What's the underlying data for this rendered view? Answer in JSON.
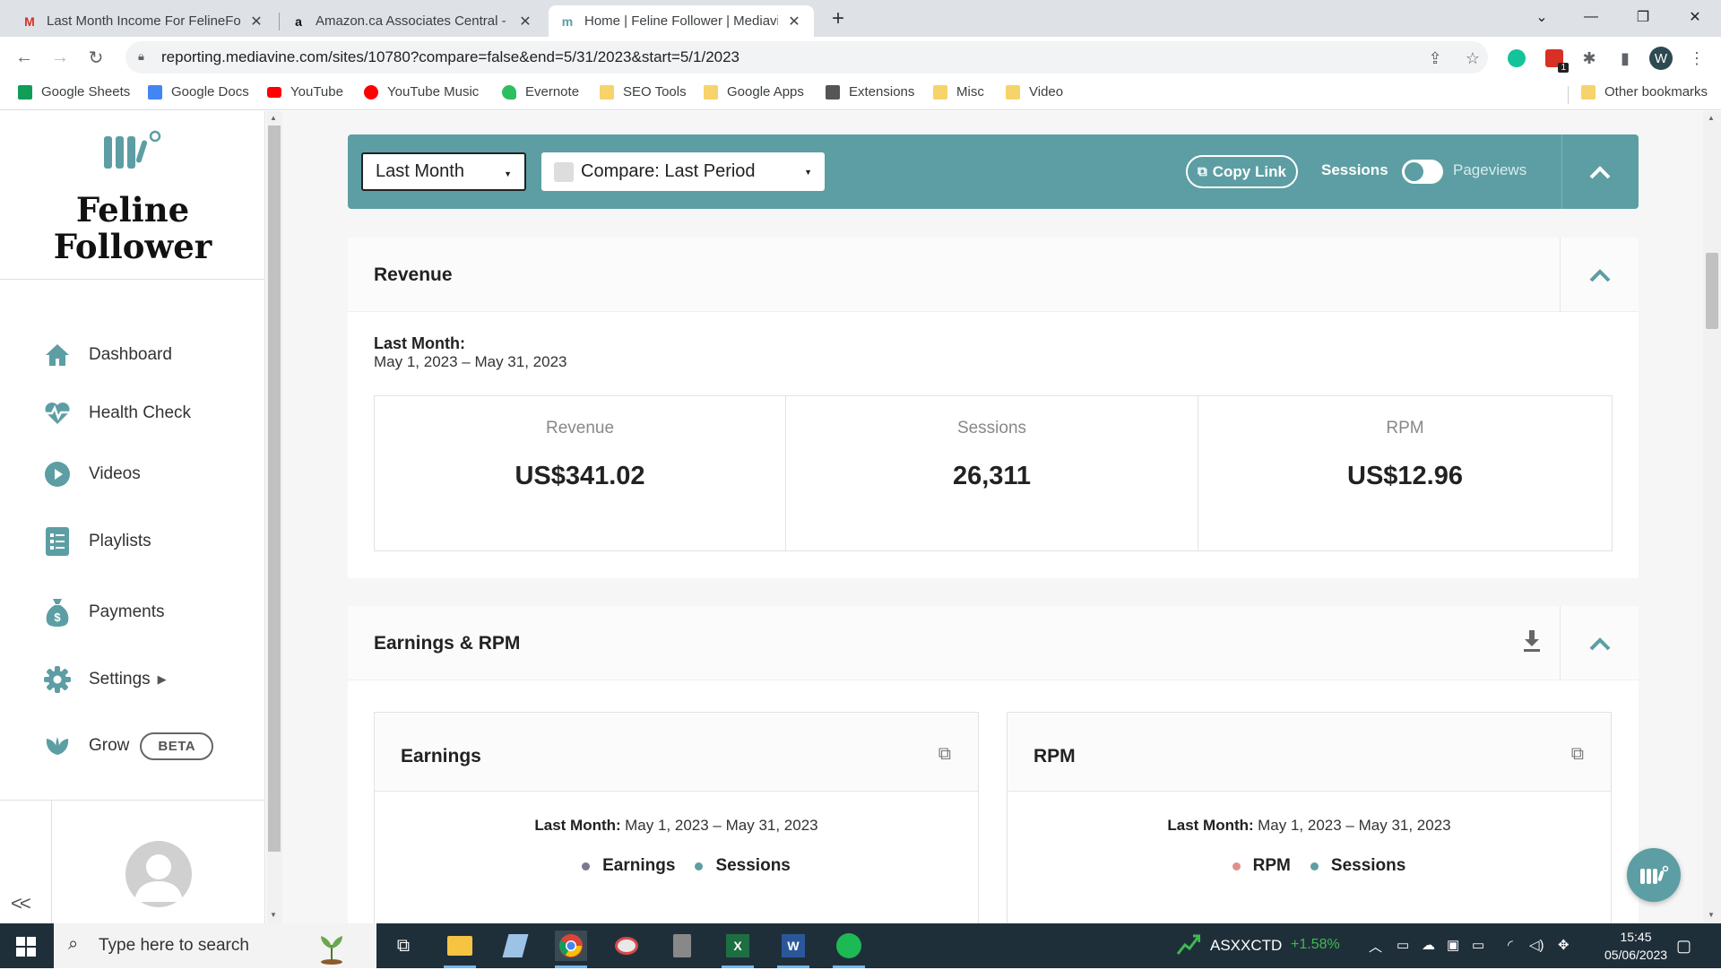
{
  "browser": {
    "tabs": [
      {
        "title": "Last Month Income For FelineFol",
        "favicon": "gmail-icon",
        "active": false
      },
      {
        "title": "Amazon.ca Associates Central - H",
        "favicon": "amazon-icon",
        "active": false
      },
      {
        "title": "Home | Feline Follower | Mediavi",
        "favicon": "mediavine-icon",
        "active": true
      }
    ],
    "url": "reporting.mediavine.com/sites/10780?compare=false&end=5/31/2023&start=5/1/2023",
    "profile_initial": "W",
    "extension_badge": "1",
    "bookmarks": [
      {
        "label": "Google Sheets",
        "color": "#0f9d58"
      },
      {
        "label": "Google Docs",
        "color": "#4285f4"
      },
      {
        "label": "YouTube",
        "color": "#ff0000"
      },
      {
        "label": "YouTube Music",
        "color": "#ff0000"
      },
      {
        "label": "Evernote",
        "color": "#2dbe60"
      },
      {
        "label": "SEO Tools",
        "color": "#f6d36b"
      },
      {
        "label": "Google Apps",
        "color": "#f6d36b"
      },
      {
        "label": "Extensions",
        "color": "#555555"
      },
      {
        "label": "Misc",
        "color": "#f6d36b"
      },
      {
        "label": "Video",
        "color": "#f6d36b"
      }
    ],
    "other_bookmarks": "Other bookmarks"
  },
  "sidebar": {
    "brand_name": "Feline Follower",
    "nav": [
      {
        "label": "Dashboard",
        "icon": "home-icon"
      },
      {
        "label": "Health Check",
        "icon": "heartbeat-icon"
      },
      {
        "label": "Videos",
        "icon": "play-circle-icon"
      },
      {
        "label": "Playlists",
        "icon": "playlist-icon"
      },
      {
        "label": "Payments",
        "icon": "money-bag-icon"
      },
      {
        "label": "Settings",
        "icon": "gear-icon"
      },
      {
        "label": "Grow",
        "icon": "leaf-icon"
      }
    ],
    "beta_badge": "BETA",
    "collapse": "<<"
  },
  "filters": {
    "period_select": "Last Month",
    "compare_select": "Compare: Last Period",
    "copy_link": "Copy Link",
    "toggle_left": "Sessions",
    "toggle_right": "Pageviews"
  },
  "revenue_card": {
    "title": "Revenue",
    "period_label": "Last Month:",
    "period_range": "May 1, 2023 – May 31, 2023",
    "stats": [
      {
        "label": "Revenue",
        "value": "US$341.02"
      },
      {
        "label": "Sessions",
        "value": "26,311"
      },
      {
        "label": "RPM",
        "value": "US$12.96"
      }
    ]
  },
  "earnings_card": {
    "title": "Earnings & RPM",
    "subcards": [
      {
        "title": "Earnings",
        "period_label": "Last Month:",
        "period_range": "May 1, 2023 – May 31, 2023",
        "legend": [
          {
            "label": "Earnings",
            "color": "#7a7790"
          },
          {
            "label": "Sessions",
            "color": "#5c9ea3"
          }
        ]
      },
      {
        "title": "RPM",
        "period_label": "Last Month:",
        "period_range": "May 1, 2023 – May 31, 2023",
        "legend": [
          {
            "label": "RPM",
            "color": "#e28f8f"
          },
          {
            "label": "Sessions",
            "color": "#5c9ea3"
          }
        ]
      }
    ]
  },
  "taskbar": {
    "search_placeholder": "Type here to search",
    "ticker": "ASXXCTD",
    "ticker_change": "+1.58%",
    "time": "15:45",
    "date": "05/06/2023"
  },
  "colors": {
    "accent": "#5c9ea3",
    "positive": "#3fb950"
  }
}
